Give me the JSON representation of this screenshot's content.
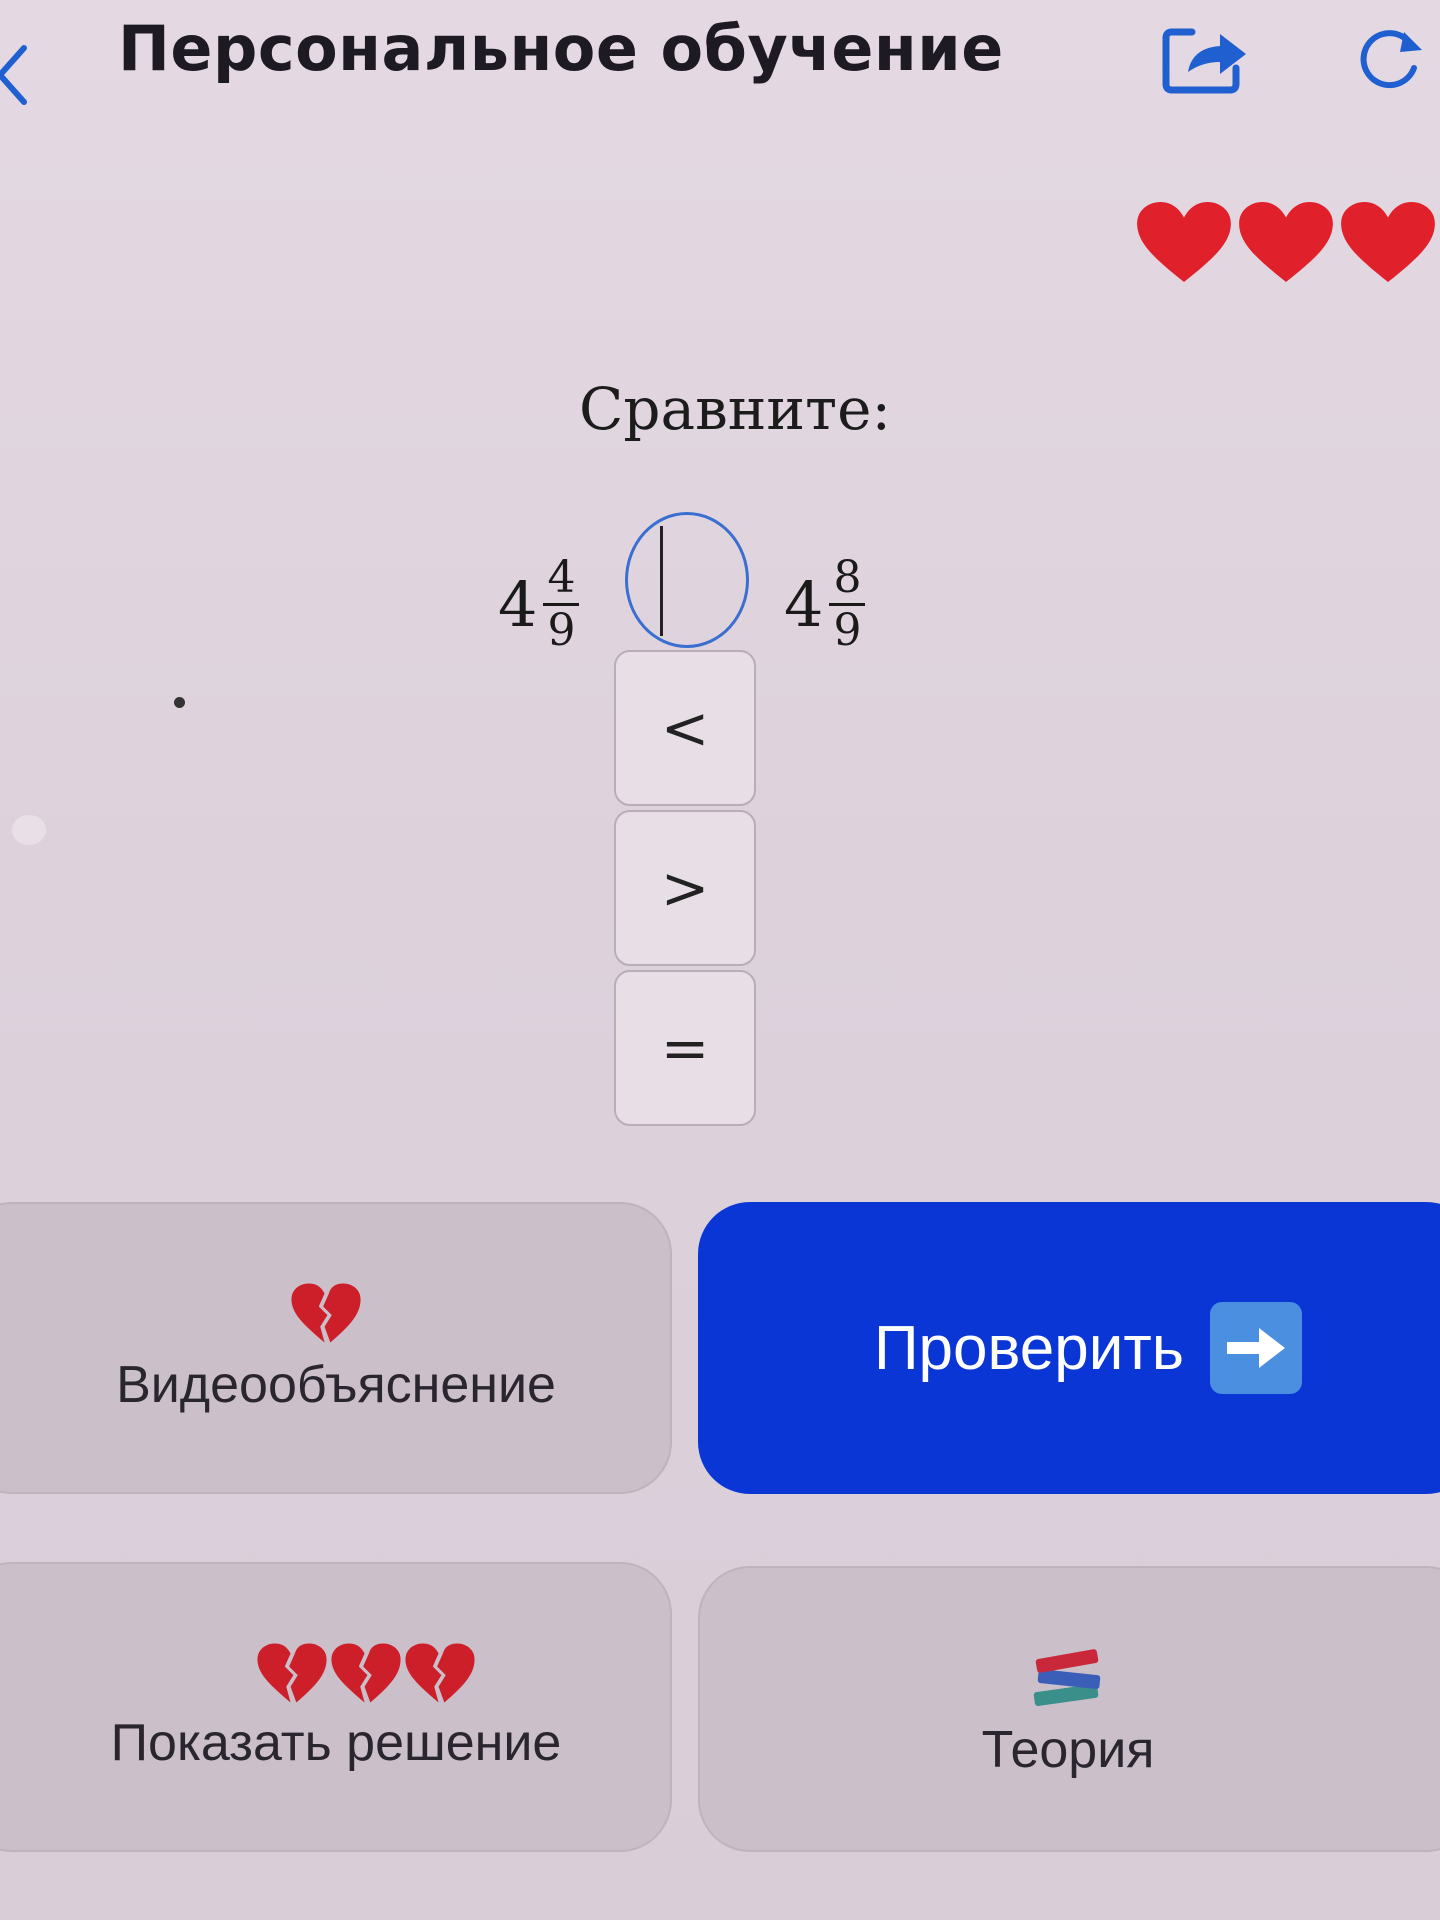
{
  "header": {
    "title": "Персональное обучение",
    "icons": [
      "back-icon",
      "share-icon",
      "refresh-icon"
    ]
  },
  "lives": {
    "count": 3,
    "color": "#e0202a"
  },
  "task": {
    "prompt": "Сравните:",
    "left": {
      "whole": "4",
      "numerator": "4",
      "denominator": "9"
    },
    "right": {
      "whole": "4",
      "numerator": "8",
      "denominator": "9"
    },
    "answer_value": ""
  },
  "options": [
    {
      "label": "<"
    },
    {
      "label": ">"
    },
    {
      "label": "="
    }
  ],
  "actions": {
    "video": {
      "label": "Видеообъяснение",
      "cost_icons": 1
    },
    "check": {
      "label": "Проверить"
    },
    "solution": {
      "label": "Показать решение",
      "cost_icons": 3
    },
    "theory": {
      "label": "Теория"
    }
  },
  "colors": {
    "accent": "#0b36d6",
    "heart": "#e0202a",
    "slot_border": "#3a6ed0",
    "share_icon": "#1f5fd0"
  }
}
